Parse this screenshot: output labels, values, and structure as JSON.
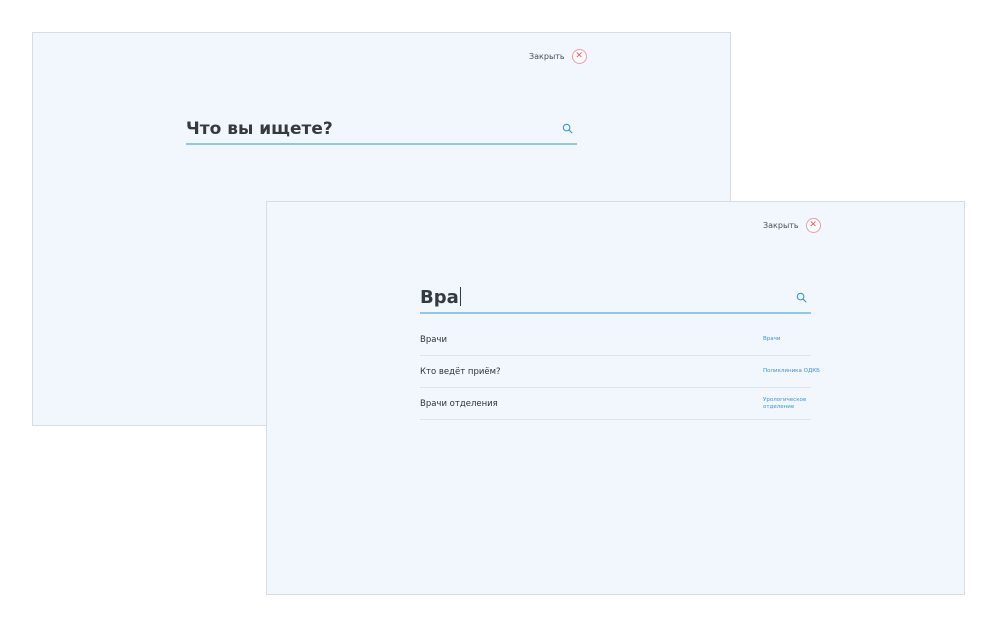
{
  "back_panel": {
    "close_label": "Закрыть",
    "close_icon": "close-icon",
    "search_placeholder": "Что вы ищете?",
    "search_icon": "search-icon"
  },
  "front_panel": {
    "close_label": "Закрыть",
    "close_icon": "close-icon",
    "search_value": "Вра",
    "search_icon": "search-icon",
    "results": [
      {
        "title": "Врачи",
        "tag": "Врачи"
      },
      {
        "title": "Кто ведёт приём?",
        "tag": "Поликлиника ОДКБ"
      },
      {
        "title": "Врачи отделения",
        "tag": "Урологическое отделение"
      }
    ]
  },
  "colors": {
    "panel_bg": "#f1f7fc",
    "accent": "#8ec9ec",
    "link": "#3c94d9",
    "close": "#e35a63"
  }
}
